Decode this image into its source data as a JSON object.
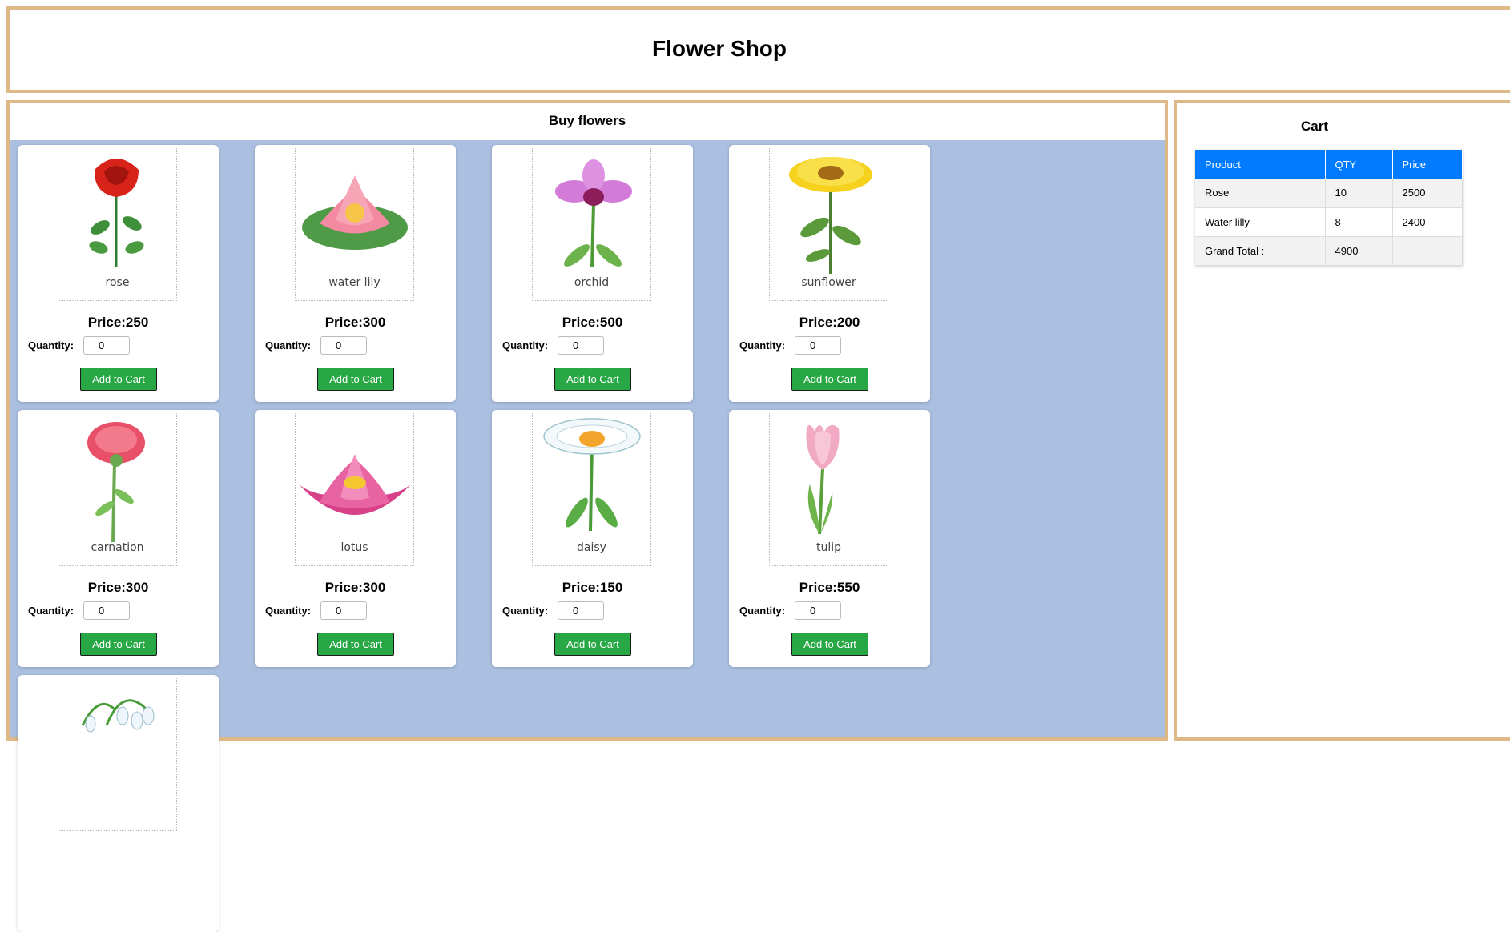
{
  "header": {
    "title": "Flower Shop"
  },
  "shop": {
    "title": "Buy flowers",
    "price_prefix": "Price:",
    "quantity_label": "Quantity:",
    "add_label": "Add to Cart",
    "products": [
      {
        "name": "rose",
        "price": "Price:250",
        "quantity": "0"
      },
      {
        "name": "water lily",
        "price": "Price:300",
        "quantity": "0"
      },
      {
        "name": "orchid",
        "price": "Price:500",
        "quantity": "0"
      },
      {
        "name": "sunflower",
        "price": "Price:200",
        "quantity": "0"
      },
      {
        "name": "carnation",
        "price": "Price:300",
        "quantity": "0"
      },
      {
        "name": "lotus",
        "price": "Price:300",
        "quantity": "0"
      },
      {
        "name": "daisy",
        "price": "Price:150",
        "quantity": "0"
      },
      {
        "name": "tulip",
        "price": "Price:550",
        "quantity": "0"
      },
      {
        "name": "",
        "price": "",
        "quantity": ""
      }
    ]
  },
  "cart": {
    "title": "Cart",
    "headers": [
      "Product",
      "QTY",
      "Price"
    ],
    "rows": [
      [
        "Rose",
        "10",
        "2500"
      ],
      [
        "Water lilly",
        "8",
        "2400"
      ]
    ],
    "total_label": "Grand Total :",
    "total_value": "4900"
  },
  "colors": {
    "border": "#deb887",
    "shop_bg": "#abbfe0",
    "button": "#28a745",
    "table_header": "#007bff"
  }
}
